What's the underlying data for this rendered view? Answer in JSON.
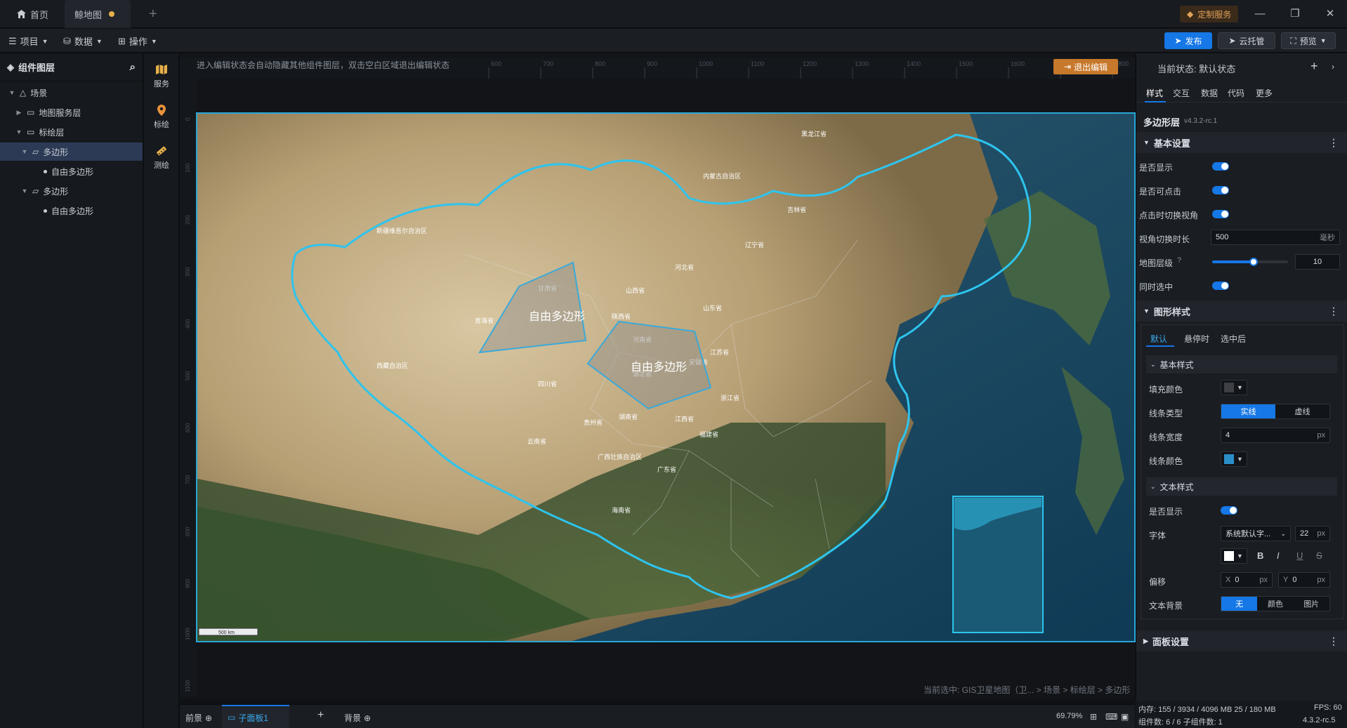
{
  "tabs": {
    "home": "首页",
    "map": "鲸地图",
    "add": "+"
  },
  "titlebar": {
    "custom_service": "定制服务",
    "minimize": "—",
    "restore": "❐",
    "close": "✕"
  },
  "toolbar": {
    "project": "项目",
    "data": "数据",
    "operate": "操作",
    "publish": "发布",
    "cloud": "云托管",
    "preview": "预览"
  },
  "layers": {
    "title": "组件图层",
    "items": [
      {
        "label": "场景"
      },
      {
        "label": "地图服务层"
      },
      {
        "label": "标绘层"
      },
      {
        "label": "多边形"
      },
      {
        "label": "自由多边形"
      },
      {
        "label": "多边形"
      },
      {
        "label": "自由多边形"
      }
    ]
  },
  "iconbar": {
    "service": "服务",
    "plot": "标绘",
    "measure": "测绘"
  },
  "canvas": {
    "hint": "进入编辑状态会自动隐藏其他组件图层，双击空白区域退出编辑状态",
    "exit_edit": "退出编辑",
    "ruler_top": [
      "600",
      "700",
      "800",
      "900",
      "1000",
      "1100",
      "1200",
      "1300",
      "1400",
      "1500",
      "1600",
      "1700",
      "1800"
    ],
    "ruler_left": [
      "0",
      "100",
      "200",
      "300",
      "400",
      "500",
      "600",
      "700",
      "800",
      "900",
      "1000",
      "1100"
    ],
    "breadcrumb": "当前选中: GIS卫星地图（卫... > 场景 > 标绘层 > 多边形",
    "scale": "500 km",
    "polygon1_label": "自由多边形",
    "polygon2_label": "自由多边形",
    "provinces": [
      "黑龙江省",
      "内蒙古自治区",
      "吉林省",
      "辽宁省",
      "新疆维吾尔自治区",
      "河北省",
      "山西省",
      "山东省",
      "甘肃省",
      "青海省",
      "陕西省",
      "河南省",
      "江苏省",
      "安徽省",
      "西藏自治区",
      "四川省",
      "湖北省",
      "浙江省",
      "湖南省",
      "江西省",
      "贵州省",
      "云南省",
      "福建省",
      "广西壮族自治区",
      "广东省",
      "海南省"
    ]
  },
  "bottom": {
    "front": "前景",
    "subpanel": "子面板1",
    "add": "+",
    "back": "背景",
    "zoom": "69.79%"
  },
  "panel": {
    "state_label": "当前状态:  默认状态",
    "tabs": [
      "样式",
      "交互",
      "数据",
      "代码",
      "更多"
    ],
    "layer_name": "多边形层",
    "version": "v4.3.2-rc.1",
    "basic": {
      "title": "基本设置",
      "show": "是否显示",
      "clickable": "是否可点击",
      "switch_view": "点击时切换视角",
      "duration_label": "视角切换时长",
      "duration": "500",
      "duration_unit": "毫秒",
      "map_level": "地图层级",
      "level_value": "10",
      "level_fraction": 0.55,
      "sync": "同时选中"
    },
    "shape": {
      "title": "图形样式",
      "subtabs": [
        "默认",
        "悬停时",
        "选中后"
      ],
      "basic_style": "基本样式",
      "fill": "填充颜色",
      "fill_color": "#3d3f44",
      "line_type": "线条类型",
      "solid": "实线",
      "dashed": "虚线",
      "line_width": "线条宽度",
      "line_width_value": "4",
      "line_color": "线条颜色",
      "line_color_value": "#2a8ec8",
      "px": "px",
      "text_style": "文本样式",
      "text_show": "是否显示",
      "font": "字体",
      "font_value": "系统默认字...",
      "font_size": "22",
      "bold": "B",
      "italic": "I",
      "underline": "U",
      "strike": "S",
      "offset": "偏移",
      "x": "X",
      "x_val": "0",
      "y": "Y",
      "y_val": "0",
      "text_bg": "文本背景",
      "bg_none": "无",
      "bg_color": "颜色",
      "bg_image": "图片"
    },
    "panel_settings": "面板设置"
  },
  "status": {
    "memory": "内存:  155 / 3934 / 4096 MB  25 / 180 MB",
    "fps": "FPS:  60",
    "components": "组件数: 6 / 6   子组件数: 1",
    "version": "4.3.2-rc.5"
  },
  "colors": {
    "accent": "#1677e6",
    "warn": "#c7782a",
    "selection": "#2aa6d8"
  }
}
